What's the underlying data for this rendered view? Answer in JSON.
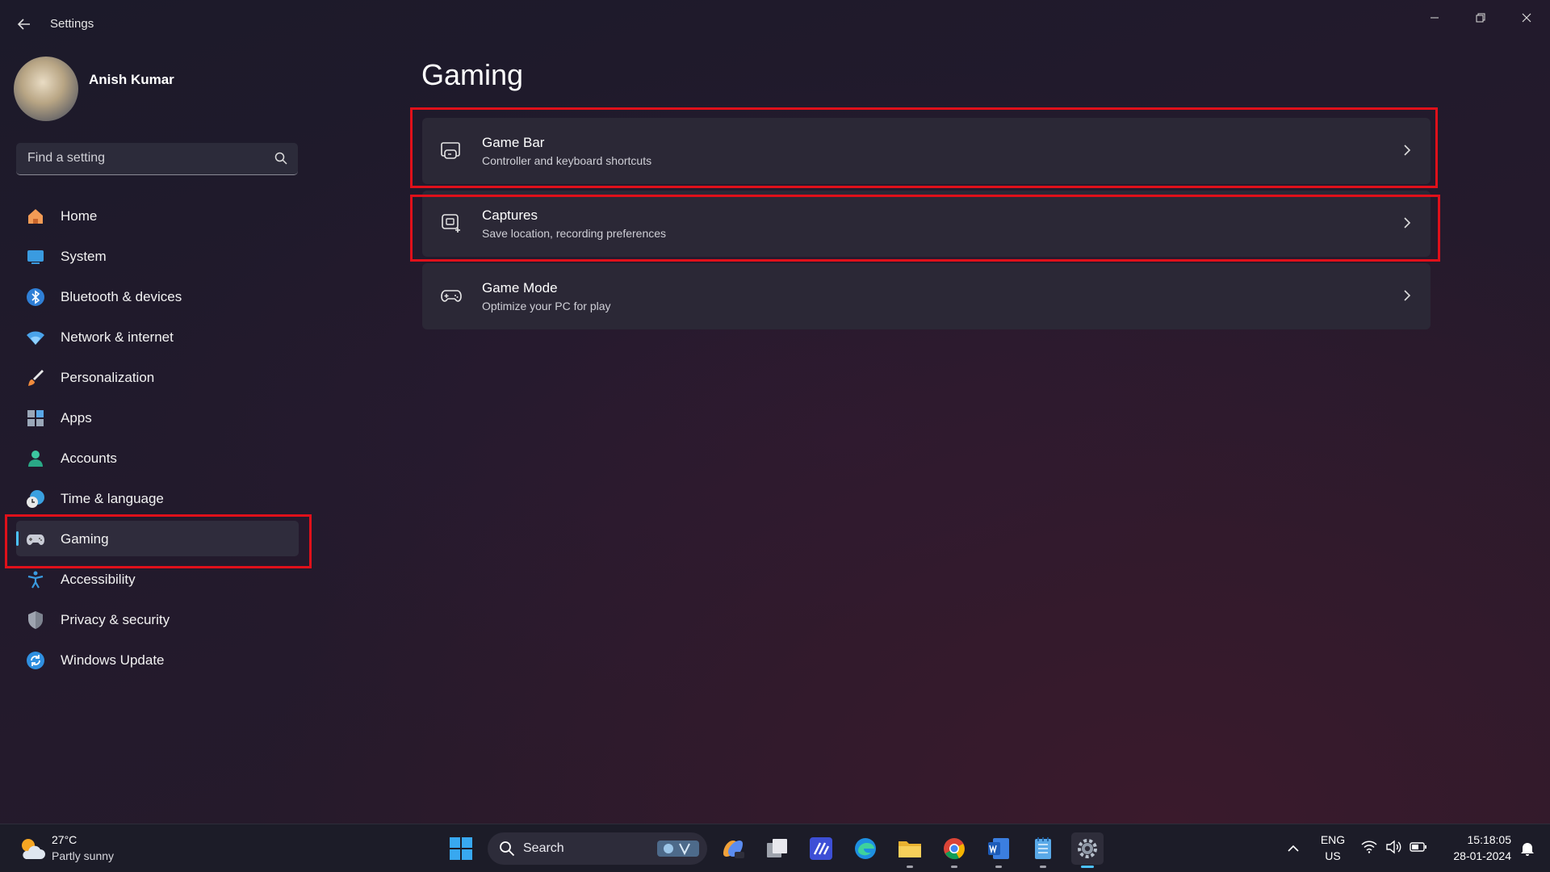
{
  "window": {
    "title": "Settings"
  },
  "profile": {
    "name": "Anish Kumar"
  },
  "search": {
    "placeholder": "Find a setting"
  },
  "sidebar": {
    "items": [
      {
        "label": "Home",
        "icon": "home-icon"
      },
      {
        "label": "System",
        "icon": "system-icon"
      },
      {
        "label": "Bluetooth & devices",
        "icon": "bluetooth-icon"
      },
      {
        "label": "Network & internet",
        "icon": "wifi-icon"
      },
      {
        "label": "Personalization",
        "icon": "brush-icon"
      },
      {
        "label": "Apps",
        "icon": "apps-icon"
      },
      {
        "label": "Accounts",
        "icon": "accounts-icon"
      },
      {
        "label": "Time & language",
        "icon": "clock-globe-icon"
      },
      {
        "label": "Gaming",
        "icon": "gamepad-icon",
        "selected": true
      },
      {
        "label": "Accessibility",
        "icon": "accessibility-icon"
      },
      {
        "label": "Privacy & security",
        "icon": "shield-icon"
      },
      {
        "label": "Windows Update",
        "icon": "update-icon"
      }
    ]
  },
  "main": {
    "title": "Gaming",
    "cards": [
      {
        "title": "Game Bar",
        "subtitle": "Controller and keyboard shortcuts",
        "icon": "game-bar-icon"
      },
      {
        "title": "Captures",
        "subtitle": "Save location, recording preferences",
        "icon": "captures-icon"
      },
      {
        "title": "Game Mode",
        "subtitle": "Optimize your PC for play",
        "icon": "game-mode-icon"
      }
    ]
  },
  "taskbar": {
    "weather_temp": "27°C",
    "weather_desc": "Partly sunny",
    "search_label": "Search",
    "lang_top": "ENG",
    "lang_bottom": "US",
    "time": "15:18:05",
    "date": "28-01-2024"
  },
  "colors": {
    "highlight": "#e0101a",
    "accent": "#4cc2ff"
  }
}
